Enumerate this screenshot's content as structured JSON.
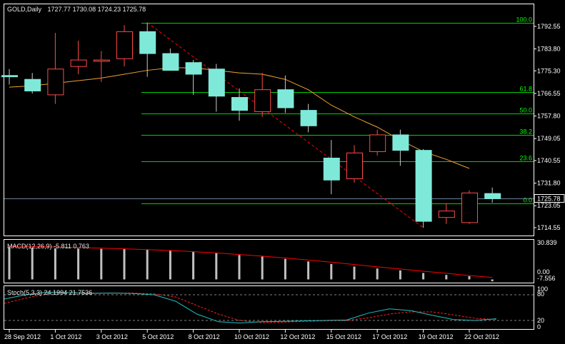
{
  "colors": {
    "background": "#000000",
    "frame": "#ffffff",
    "bull_body": "#000000",
    "bull_border": "#ff4a4a",
    "bear_body": "#7fe9d9",
    "bear_border": "#7fe9d9",
    "wick": "#c8c8c8",
    "ma": "#f0a030",
    "fib": "#00d000",
    "fib_label": "#00ff00",
    "trend": "#ff0000",
    "price_line": "#6e7f94",
    "macd_hist": "#c0c0c0",
    "macd_signal": "#ff0000",
    "stoch_main": "#20c0c0",
    "stoch_signal": "#ff2020",
    "stoch_level": "#808080"
  },
  "header": {
    "symbol": "GOLD,Daily",
    "ohlc": "1727.77 1730.08 1724.23 1725.78"
  },
  "chart_data": [
    {
      "type": "candlestick",
      "ylim": [
        1711.5,
        1797.5
      ],
      "y_ticks": [
        "1792.55",
        "1783.80",
        "1775.30",
        "1766.55",
        "1757.80",
        "1749.05",
        "1740.55",
        "1731.80",
        "1723.05",
        "1714.55"
      ],
      "current_price": "1725.78",
      "x_labels": [
        "28 Sep 2012",
        "1 Oct 2012",
        "3 Oct 2012",
        "5 Oct 2012",
        "8 Oct 2012",
        "10 Oct 2012",
        "12 Oct 2012",
        "15 Oct 2012",
        "17 Oct 2012",
        "19 Oct 2012",
        "22 Oct 2012"
      ],
      "candles": [
        {
          "o": 1773.5,
          "h": 1776.0,
          "l": 1770.0,
          "c": 1773.0
        },
        {
          "o": 1772.0,
          "h": 1774.5,
          "l": 1766.5,
          "c": 1767.5
        },
        {
          "o": 1766.0,
          "h": 1790.0,
          "l": 1762.5,
          "c": 1776.0
        },
        {
          "o": 1777.0,
          "h": 1787.0,
          "l": 1774.0,
          "c": 1779.5
        },
        {
          "o": 1779.0,
          "h": 1783.0,
          "l": 1771.0,
          "c": 1779.5
        },
        {
          "o": 1780.0,
          "h": 1793.0,
          "l": 1777.0,
          "c": 1790.5
        },
        {
          "o": 1790.5,
          "h": 1794.0,
          "l": 1773.0,
          "c": 1782.0
        },
        {
          "o": 1782.0,
          "h": 1784.0,
          "l": 1776.0,
          "c": 1775.5
        },
        {
          "o": 1778.5,
          "h": 1779.5,
          "l": 1766.0,
          "c": 1774.0
        },
        {
          "o": 1776.0,
          "h": 1778.0,
          "l": 1759.5,
          "c": 1765.5
        },
        {
          "o": 1765.0,
          "h": 1768.5,
          "l": 1756.0,
          "c": 1760.0
        },
        {
          "o": 1759.5,
          "h": 1774.5,
          "l": 1757.5,
          "c": 1768.0
        },
        {
          "o": 1768.0,
          "h": 1773.5,
          "l": 1759.0,
          "c": 1761.0
        },
        {
          "o": 1760.0,
          "h": 1762.5,
          "l": 1751.5,
          "c": 1754.0
        },
        {
          "o": 1741.5,
          "h": 1748.5,
          "l": 1727.5,
          "c": 1733.0
        },
        {
          "o": 1733.5,
          "h": 1746.5,
          "l": 1732.0,
          "c": 1743.5
        },
        {
          "o": 1744.0,
          "h": 1752.5,
          "l": 1742.5,
          "c": 1750.5
        },
        {
          "o": 1750.5,
          "h": 1752.5,
          "l": 1738.5,
          "c": 1744.5
        },
        {
          "o": 1744.5,
          "h": 1745.0,
          "l": 1714.5,
          "c": 1717.0
        },
        {
          "o": 1718.5,
          "h": 1724.0,
          "l": 1716.0,
          "c": 1721.0
        },
        {
          "o": 1716.5,
          "h": 1729.0,
          "l": 1716.0,
          "c": 1728.0
        },
        {
          "o": 1727.77,
          "h": 1730.08,
          "l": 1724.23,
          "c": 1725.78
        }
      ],
      "moving_average": [
        1769.0,
        1769.5,
        1770.5,
        1771.5,
        1772.5,
        1774.0,
        1775.5,
        1776.5,
        1776.5,
        1775.5,
        1774.5,
        1774.0,
        1772.0,
        1768.0,
        1762.0,
        1757.5,
        1753.5,
        1748.5,
        1744.0,
        1741.0,
        1737.5
      ],
      "fibonacci": [
        {
          "label": "100.0",
          "price": 1794.0
        },
        {
          "label": "61.8",
          "price": 1767.1
        },
        {
          "label": "50.0",
          "price": 1758.8
        },
        {
          "label": "38.2",
          "price": 1750.5
        },
        {
          "label": "23.6",
          "price": 1740.3
        },
        {
          "label": "0.0",
          "price": 1723.9
        }
      ]
    },
    {
      "type": "bar",
      "name": "MACD(12,26,9)",
      "values_label": "-5.811 0.763",
      "ylim": [
        -2.5,
        30.839
      ],
      "y_ticks": [
        "30.839",
        "0.00",
        "-7.556"
      ],
      "histogram": [
        25,
        24.5,
        24.2,
        24.0,
        23.8,
        23.6,
        23.3,
        22.8,
        21.5,
        20.5,
        19.0,
        17.8,
        16.0,
        14.0,
        12.0,
        10.0,
        8.5,
        7.0,
        5.0,
        3.5,
        2.5,
        -1.5
      ],
      "signal": [
        26,
        25.6,
        25.2,
        24.8,
        24.3,
        23.8,
        23.2,
        22.5,
        21.6,
        20.6,
        19.4,
        18.1,
        16.7,
        15.1,
        13.4,
        11.6,
        9.8,
        8.1,
        6.4,
        4.8,
        3.0,
        1.5
      ]
    },
    {
      "type": "line",
      "name": "Stoch(5,3,3)",
      "values_label": "24.1994 21.7536",
      "ylim": [
        0,
        100
      ],
      "y_ticks": [
        "100",
        "80",
        "20",
        "0"
      ],
      "levels": [
        80,
        20
      ],
      "main": [
        70,
        80,
        86,
        85,
        83,
        84,
        83,
        80,
        65,
        35,
        17,
        14,
        17,
        18,
        19,
        20,
        21,
        37,
        47,
        43,
        32,
        22,
        20,
        24
      ],
      "signal": [
        60,
        72,
        82,
        85,
        84,
        84,
        84,
        82,
        75,
        55,
        35,
        20,
        15,
        16,
        18,
        19,
        20,
        26,
        35,
        40,
        40,
        33,
        25,
        22
      ]
    }
  ]
}
